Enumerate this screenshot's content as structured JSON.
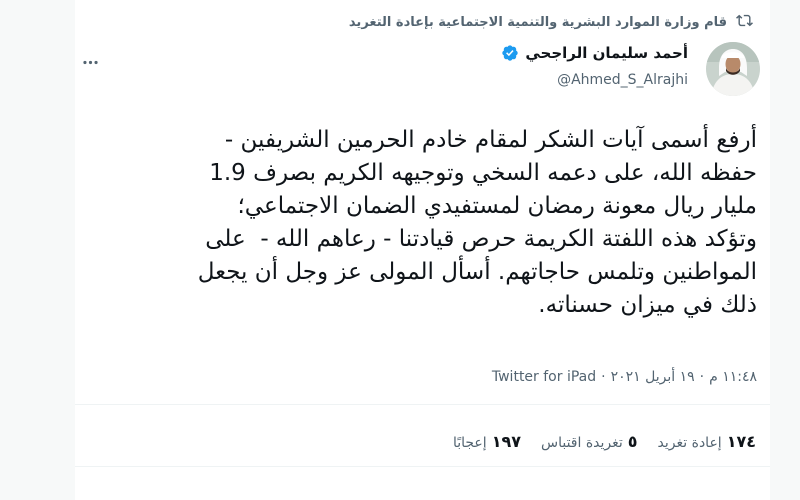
{
  "retweet": {
    "icon": "retweet-icon",
    "text": "قام وزارة الموارد البشرية والتنمية الاجتماعية بإعادة التغريد"
  },
  "author": {
    "name": "أحمد سليمان الراجحي",
    "handle": "@Ahmed_S_Alrajhi",
    "verified": true
  },
  "tweet": {
    "text": "أرفع أسمى آيات الشكر لمقام خادم الحرمين الشريفين -\nحفظه الله، على دعمه السخي وتوجيهه الكريم بصرف 1.9\nمليار ريال معونة رمضان لمستفيدي الضمان الاجتماعي؛\nوتؤكد هذه اللفتة الكريمة حرص قيادتنا - رعاهم الله -  على\nالمواطنين وتلمس حاجاتهم. أسأل المولى عز وجل أن يجعل\nذلك في ميزان حسناته."
  },
  "meta": {
    "time": "١١:٤٨ م",
    "date": "١٩ أبريل ٢٠٢١",
    "sep": "·",
    "source": "Twitter for iPad"
  },
  "stats": {
    "retweets": {
      "count": "١٧٤",
      "label": "إعادة تغريد"
    },
    "quotes": {
      "count": "٥",
      "label": "تغريدة اقتباس"
    },
    "likes": {
      "count": "١٩٧",
      "label": "إعجابًا"
    }
  },
  "colors": {
    "text": "#0f1419",
    "secondary": "#536471",
    "verified": "#1d9bf0",
    "divider": "#eff3f4"
  }
}
